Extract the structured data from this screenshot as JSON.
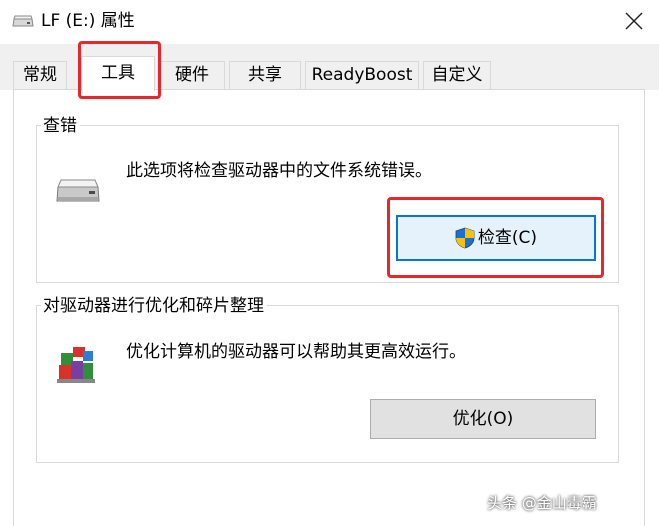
{
  "window": {
    "title": "LF (E:) 属性",
    "icon": "drive-icon",
    "close_icon": "close-icon"
  },
  "tabs": [
    {
      "label": "常规",
      "active": false
    },
    {
      "label": "工具",
      "active": true
    },
    {
      "label": "硬件",
      "active": false
    },
    {
      "label": "共享",
      "active": false
    },
    {
      "label": "ReadyBoost",
      "active": false
    },
    {
      "label": "自定义",
      "active": false
    }
  ],
  "error_check": {
    "title": "查错",
    "icon": "drive-icon",
    "description": "此选项将检查驱动器中的文件系统错误。",
    "button_label": "检查(C)",
    "button_icon": "uac-shield-icon"
  },
  "optimize": {
    "title": "对驱动器进行优化和碎片整理",
    "icon": "defrag-icon",
    "description": "优化计算机的驱动器可以帮助其更高效运行。",
    "button_label": "优化(O)"
  },
  "annotations": {
    "highlight_color": "#e8272a"
  },
  "watermark": "头条 @金山毒霸"
}
